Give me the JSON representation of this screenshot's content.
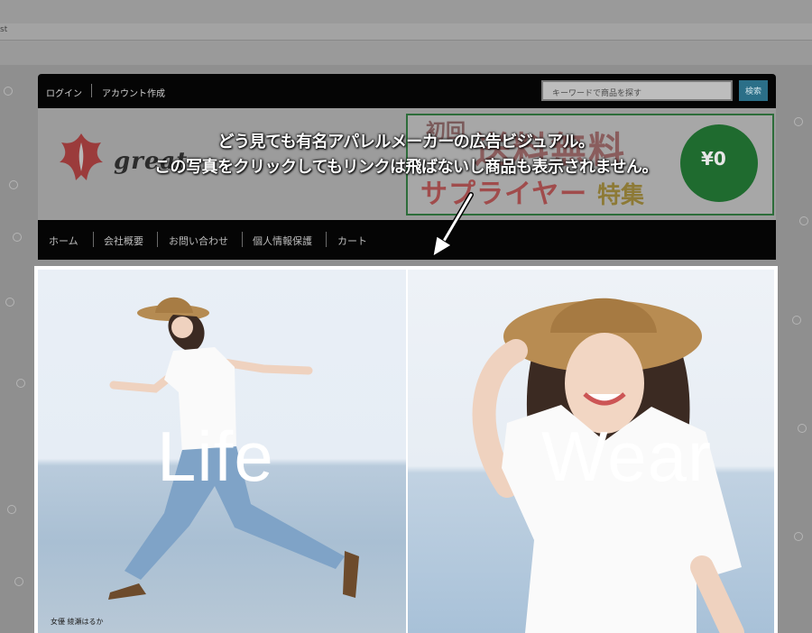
{
  "browser": {
    "tab_label": "st"
  },
  "topbar": {
    "login": "ログイン",
    "create_account": "アカウント作成",
    "search_placeholder": "キーワードで商品を探す",
    "search_button": "検索"
  },
  "banner": {
    "logo_text": "great",
    "promo_small": "初回",
    "promo_big": "送料無料",
    "promo_sub": "サプライヤー",
    "promo_sub2": "特集",
    "promo_circle": "¥0"
  },
  "nav": {
    "items": [
      "ホーム",
      "会社概要",
      "お問い合わせ",
      "個人情報保護",
      "カート"
    ]
  },
  "annotation": {
    "line1": "どう見ても有名アパレルメーカーの広告ビジュアル。",
    "line2": "この写真をクリックしてもリンクは飛ばないし商品も表示されません。"
  },
  "hero": {
    "left_word": "Life",
    "right_word": "Wear",
    "caption": "女優 綾瀬はるか"
  },
  "colors": {
    "bar_bg": "#050505",
    "search_button": "#2b6f88",
    "promo_green": "#1f6b2f",
    "logo_red": "#b21f1f"
  }
}
